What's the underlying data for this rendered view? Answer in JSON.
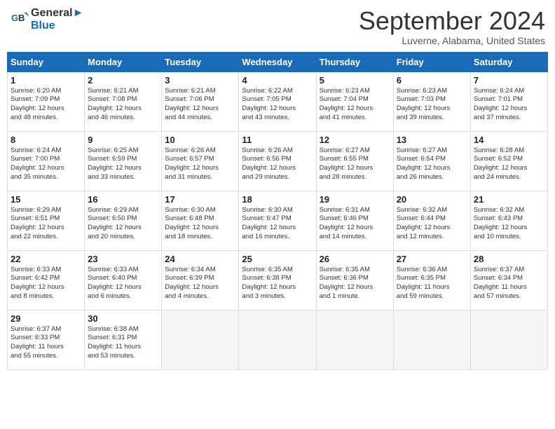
{
  "header": {
    "logo_line1": "General",
    "logo_line2": "Blue",
    "month": "September 2024",
    "location": "Luverne, Alabama, United States"
  },
  "weekdays": [
    "Sunday",
    "Monday",
    "Tuesday",
    "Wednesday",
    "Thursday",
    "Friday",
    "Saturday"
  ],
  "weeks": [
    [
      {
        "day": "1",
        "text": "Sunrise: 6:20 AM\nSunset: 7:09 PM\nDaylight: 12 hours\nand 48 minutes."
      },
      {
        "day": "2",
        "text": "Sunrise: 6:21 AM\nSunset: 7:08 PM\nDaylight: 12 hours\nand 46 minutes."
      },
      {
        "day": "3",
        "text": "Sunrise: 6:21 AM\nSunset: 7:06 PM\nDaylight: 12 hours\nand 44 minutes."
      },
      {
        "day": "4",
        "text": "Sunrise: 6:22 AM\nSunset: 7:05 PM\nDaylight: 12 hours\nand 43 minutes."
      },
      {
        "day": "5",
        "text": "Sunrise: 6:23 AM\nSunset: 7:04 PM\nDaylight: 12 hours\nand 41 minutes."
      },
      {
        "day": "6",
        "text": "Sunrise: 6:23 AM\nSunset: 7:03 PM\nDaylight: 12 hours\nand 39 minutes."
      },
      {
        "day": "7",
        "text": "Sunrise: 6:24 AM\nSunset: 7:01 PM\nDaylight: 12 hours\nand 37 minutes."
      }
    ],
    [
      {
        "day": "8",
        "text": "Sunrise: 6:24 AM\nSunset: 7:00 PM\nDaylight: 12 hours\nand 35 minutes."
      },
      {
        "day": "9",
        "text": "Sunrise: 6:25 AM\nSunset: 6:59 PM\nDaylight: 12 hours\nand 33 minutes."
      },
      {
        "day": "10",
        "text": "Sunrise: 6:26 AM\nSunset: 6:57 PM\nDaylight: 12 hours\nand 31 minutes."
      },
      {
        "day": "11",
        "text": "Sunrise: 6:26 AM\nSunset: 6:56 PM\nDaylight: 12 hours\nand 29 minutes."
      },
      {
        "day": "12",
        "text": "Sunrise: 6:27 AM\nSunset: 6:55 PM\nDaylight: 12 hours\nand 28 minutes."
      },
      {
        "day": "13",
        "text": "Sunrise: 6:27 AM\nSunset: 6:54 PM\nDaylight: 12 hours\nand 26 minutes."
      },
      {
        "day": "14",
        "text": "Sunrise: 6:28 AM\nSunset: 6:52 PM\nDaylight: 12 hours\nand 24 minutes."
      }
    ],
    [
      {
        "day": "15",
        "text": "Sunrise: 6:29 AM\nSunset: 6:51 PM\nDaylight: 12 hours\nand 22 minutes."
      },
      {
        "day": "16",
        "text": "Sunrise: 6:29 AM\nSunset: 6:50 PM\nDaylight: 12 hours\nand 20 minutes."
      },
      {
        "day": "17",
        "text": "Sunrise: 6:30 AM\nSunset: 6:48 PM\nDaylight: 12 hours\nand 18 minutes."
      },
      {
        "day": "18",
        "text": "Sunrise: 6:30 AM\nSunset: 6:47 PM\nDaylight: 12 hours\nand 16 minutes."
      },
      {
        "day": "19",
        "text": "Sunrise: 6:31 AM\nSunset: 6:46 PM\nDaylight: 12 hours\nand 14 minutes."
      },
      {
        "day": "20",
        "text": "Sunrise: 6:32 AM\nSunset: 6:44 PM\nDaylight: 12 hours\nand 12 minutes."
      },
      {
        "day": "21",
        "text": "Sunrise: 6:32 AM\nSunset: 6:43 PM\nDaylight: 12 hours\nand 10 minutes."
      }
    ],
    [
      {
        "day": "22",
        "text": "Sunrise: 6:33 AM\nSunset: 6:42 PM\nDaylight: 12 hours\nand 8 minutes."
      },
      {
        "day": "23",
        "text": "Sunrise: 6:33 AM\nSunset: 6:40 PM\nDaylight: 12 hours\nand 6 minutes."
      },
      {
        "day": "24",
        "text": "Sunrise: 6:34 AM\nSunset: 6:39 PM\nDaylight: 12 hours\nand 4 minutes."
      },
      {
        "day": "25",
        "text": "Sunrise: 6:35 AM\nSunset: 6:38 PM\nDaylight: 12 hours\nand 3 minutes."
      },
      {
        "day": "26",
        "text": "Sunrise: 6:35 AM\nSunset: 6:36 PM\nDaylight: 12 hours\nand 1 minute."
      },
      {
        "day": "27",
        "text": "Sunrise: 6:36 AM\nSunset: 6:35 PM\nDaylight: 11 hours\nand 59 minutes."
      },
      {
        "day": "28",
        "text": "Sunrise: 6:37 AM\nSunset: 6:34 PM\nDaylight: 11 hours\nand 57 minutes."
      }
    ],
    [
      {
        "day": "29",
        "text": "Sunrise: 6:37 AM\nSunset: 6:33 PM\nDaylight: 11 hours\nand 55 minutes."
      },
      {
        "day": "30",
        "text": "Sunrise: 6:38 AM\nSunset: 6:31 PM\nDaylight: 11 hours\nand 53 minutes."
      },
      {
        "day": "",
        "text": ""
      },
      {
        "day": "",
        "text": ""
      },
      {
        "day": "",
        "text": ""
      },
      {
        "day": "",
        "text": ""
      },
      {
        "day": "",
        "text": ""
      }
    ]
  ]
}
